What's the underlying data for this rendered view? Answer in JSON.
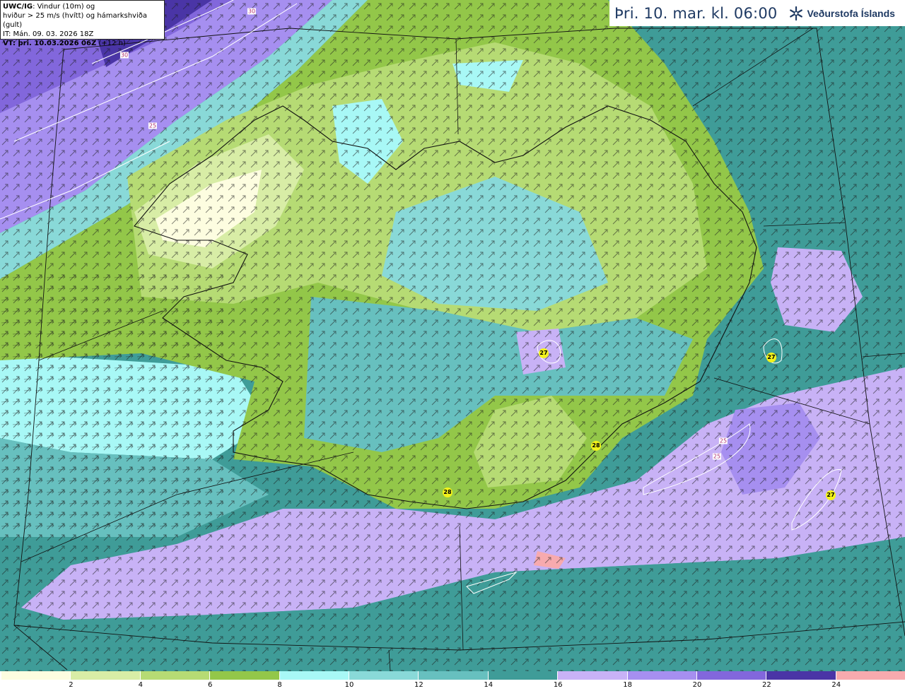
{
  "info": {
    "line1_bold": "UWC/IG",
    "line1_rest": ": Vindur (10m) og",
    "line2": "hviður > 25 m/s (hvítt) og hámarkshviða (gult)",
    "line3": "IT: Mán. 09. 03. 2026 18Z",
    "line4_bold": "VT: þri. 10.03.2026 06Z",
    "line4_rest": " (+12 h)"
  },
  "title": "Þri. 10. mar. kl. 06:00",
  "logo_text": "Veðurstofa Íslands",
  "colorbar": {
    "colors": [
      "#fdfde0",
      "#d8eda6",
      "#b6db74",
      "#93c749",
      "#a8f8f6",
      "#89d9d8",
      "#67c0bf",
      "#3f9c98",
      "#c8b2f6",
      "#a68ff0",
      "#8267dc",
      "#4a35a6",
      "#f7aaae"
    ],
    "ticks": [
      "2",
      "4",
      "6",
      "8",
      "10",
      "12",
      "14",
      "16",
      "18",
      "20",
      "22",
      "24"
    ]
  },
  "gust_labels": [
    "27",
    "27",
    "28",
    "28",
    "27"
  ],
  "contour_labels": [
    "30",
    "30",
    "25",
    "25",
    "25"
  ]
}
